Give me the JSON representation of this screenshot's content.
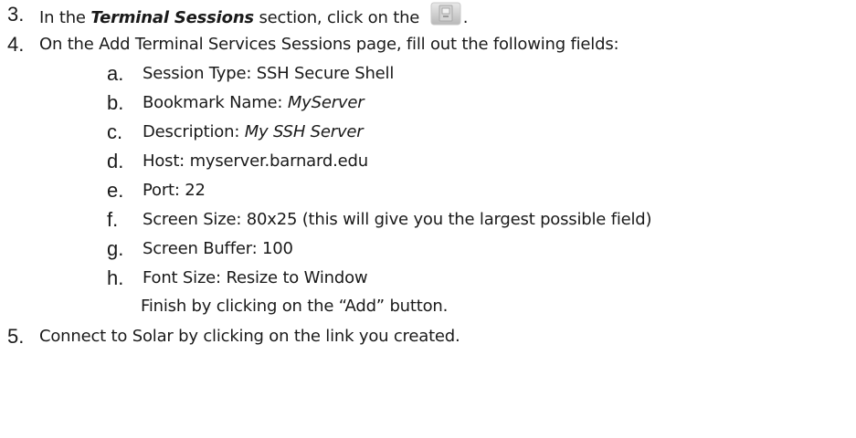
{
  "steps": [
    {
      "number": "3.",
      "text_before": "In the ",
      "emphasis": "Terminal Sessions",
      "text_middle": " section, click on the ",
      "icon": "terminal-session-add-icon",
      "text_after": "."
    },
    {
      "number": "4.",
      "text": "On the Add Terminal Services Sessions page, fill out the following fields:",
      "fields": [
        {
          "letter": "a.",
          "label": "Session Type: ",
          "value": "SSH Secure Shell",
          "italic": false
        },
        {
          "letter": "b.",
          "label": "Bookmark Name: ",
          "value": "MyServer",
          "italic": true
        },
        {
          "letter": "c.",
          "label": "Description: ",
          "value": "My SSH Server",
          "italic": true
        },
        {
          "letter": "d.",
          "label": "Host: ",
          "value": "myserver.barnard.edu",
          "italic": false
        },
        {
          "letter": "e.",
          "label": "Port: ",
          "value": "22",
          "italic": false
        },
        {
          "letter": "f.",
          "label": "Screen Size: ",
          "value": "80x25 (this will give you the largest possible field)",
          "italic": false
        },
        {
          "letter": "g.",
          "label": "Screen Buffer: ",
          "value": "100",
          "italic": false
        },
        {
          "letter": "h.",
          "label": "Font Size: ",
          "value": "Resize to Window",
          "italic": false
        }
      ],
      "finish_text": "Finish by clicking on the “Add” button."
    },
    {
      "number": "5.",
      "text": "Connect to Solar by clicking on the link you created."
    }
  ]
}
